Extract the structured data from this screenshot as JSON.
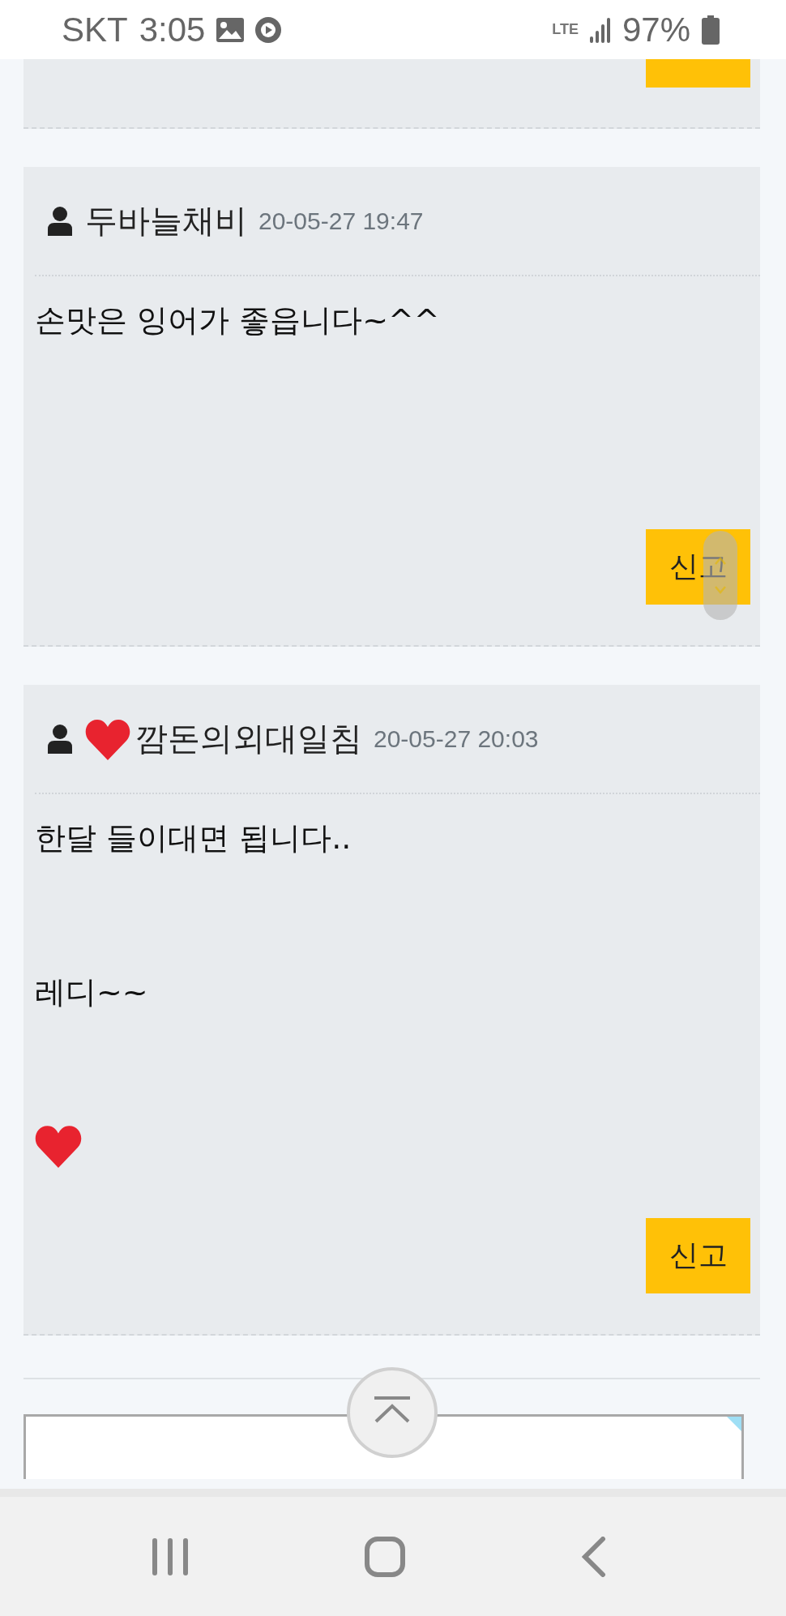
{
  "status_bar": {
    "carrier": "SKT",
    "time": "3:05",
    "network": "LTE",
    "battery": "97%"
  },
  "comments": [
    {
      "kind": "cut"
    },
    {
      "kind": "full",
      "author": "두바늘채비",
      "heart_badge": false,
      "date": "20-05-27 19:47",
      "lines": [
        {
          "kind": "text",
          "text": "손맛은 잉어가 좋읍니다~^^"
        }
      ],
      "button": "신고"
    },
    {
      "kind": "full",
      "author": "깜돈의외대일침",
      "heart_badge": true,
      "date": "20-05-27 20:03",
      "lines": [
        {
          "kind": "text",
          "text": "한달 들이대면 됩니다.."
        },
        {
          "kind": "text",
          "text": "레디~~"
        },
        {
          "kind": "heart"
        }
      ],
      "button": "신고"
    }
  ]
}
